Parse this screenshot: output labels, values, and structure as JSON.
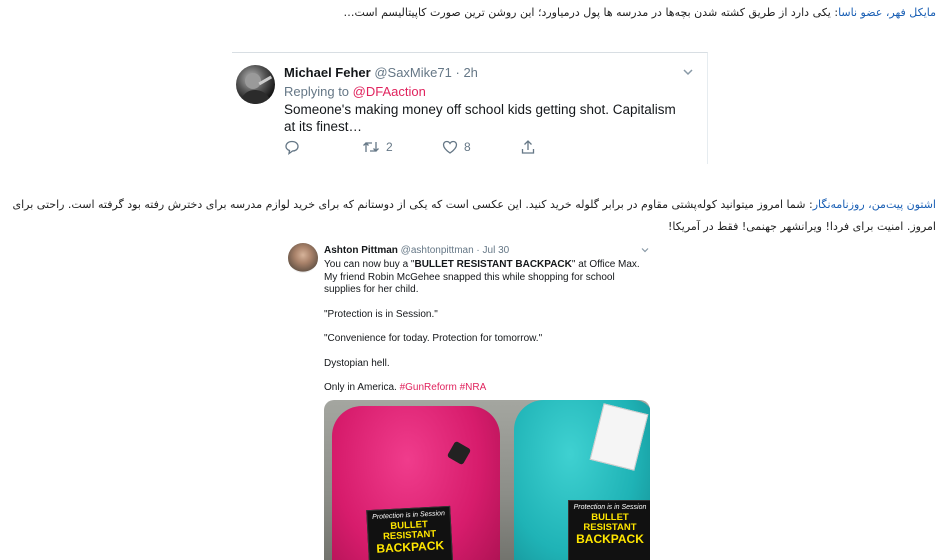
{
  "paragraph1": {
    "author": "مایکل فهر، عضو ناسا",
    "text": ": یکی دارد از طریق کشته شدن بچه‌ها در مدرسه ها پول درمیاورد؛ این روشن ترین صورت کاپیتالیسم است…"
  },
  "tweet1": {
    "name": "Michael Feher",
    "handle": "@SaxMike71",
    "dot": "·",
    "time": "2h",
    "reply_prefix": "Replying to",
    "reply_to": "@DFAaction",
    "text": "Someone's making money off school kids getting shot. Capitalism at its finest…",
    "retweets": "2",
    "likes": "8"
  },
  "paragraph2": {
    "author": "اشتون پیت‌من، روزنامه‌نگار",
    "text": ": شما امروز میتوانید کوله‌پشتی مقاوم در برابر گلوله خرید کنید. این عکسی است که یکی از دوستانم که برای خرید لوازم مدرسه برای دخترش رفته بود گرفته است. راحتی برای امروز. امنیت برای فردا! ویرانشهر جهنمی! فقط در آمریکا!"
  },
  "tweet2": {
    "name": "Ashton Pittman",
    "handle": "@ashtonpittman",
    "dot": "·",
    "time": "Jul 30",
    "line1_pre": "You can now buy a \"",
    "line1_bold": "BULLET RESISTANT BACKPACK",
    "line1_post": "\" at Office Max. My friend Robin McGehee snapped this while shopping for school supplies for her child.",
    "quote1": "\"Protection is in Session.\"",
    "quote2": "\"Convenience for today. Protection for tomorrow.\"",
    "line4": "Dystopian hell.",
    "line5": "Only in America.",
    "hashtag1": "#GunReform",
    "hashtag2": "#NRA",
    "photo_label1": "Protection is in Session",
    "photo_label2": "BULLET RESISTANT",
    "photo_label3": "BACKPACK"
  },
  "colors": {
    "accent_link": "#1a5fb4",
    "mention": "#e0245e",
    "muted": "#657786"
  }
}
